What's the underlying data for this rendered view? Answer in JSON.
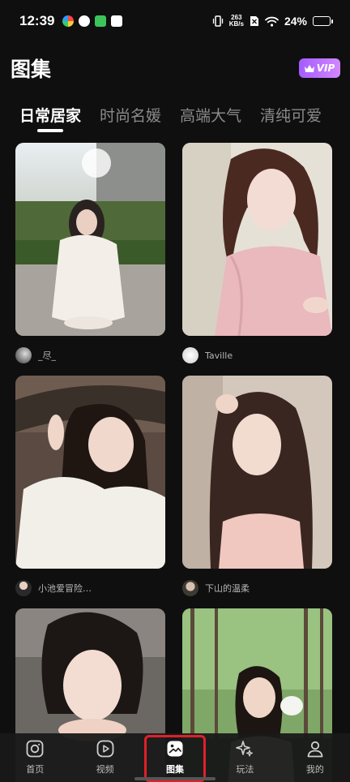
{
  "status_bar": {
    "time": "12:39",
    "net_speed_value": "263",
    "net_speed_unit": "KB/s",
    "battery": "24%",
    "battery_level": 0.24,
    "icons": [
      "app-notification-icon",
      "app-notification-icon",
      "app-notification-icon",
      "app-notification-icon",
      "vibrate-icon",
      "sim-off-icon",
      "wifi-icon",
      "battery-icon"
    ]
  },
  "header": {
    "title": "图集",
    "vip_label": "VIP"
  },
  "tabs": [
    {
      "label": "日常居家",
      "active": true
    },
    {
      "label": "时尚名媛",
      "active": false
    },
    {
      "label": "高端大气",
      "active": false
    },
    {
      "label": "清纯可爱",
      "active": false
    }
  ],
  "cards": [
    {
      "author": "_尽_",
      "image": "photo-woman-white-sweater-crouching-outdoors"
    },
    {
      "author": "Taville",
      "image": "photo-woman-pink-dress-peace-sign"
    },
    {
      "author": "小池爱冒险…",
      "image": "photo-woman-white-sweater-car-peace-sign"
    },
    {
      "author": "下山的温柔",
      "image": "photo-woman-long-hair-pink-top"
    },
    {
      "author": "",
      "image": "photo-woman-hand-on-chin"
    },
    {
      "author": "",
      "image": "photo-woman-in-forest"
    }
  ],
  "bottom_nav": [
    {
      "label": "首页",
      "icon": "camera-icon",
      "active": false
    },
    {
      "label": "视频",
      "icon": "play-icon",
      "active": false
    },
    {
      "label": "图集",
      "icon": "image-icon",
      "active": true
    },
    {
      "label": "玩法",
      "icon": "sparkle-icon",
      "active": false
    },
    {
      "label": "我的",
      "icon": "user-icon",
      "active": false
    }
  ],
  "colors": {
    "background": "#0f0f0f",
    "vip_gradient_start": "#a45cff",
    "vip_gradient_end": "#d287ff",
    "active_highlight": "#e0202a"
  }
}
